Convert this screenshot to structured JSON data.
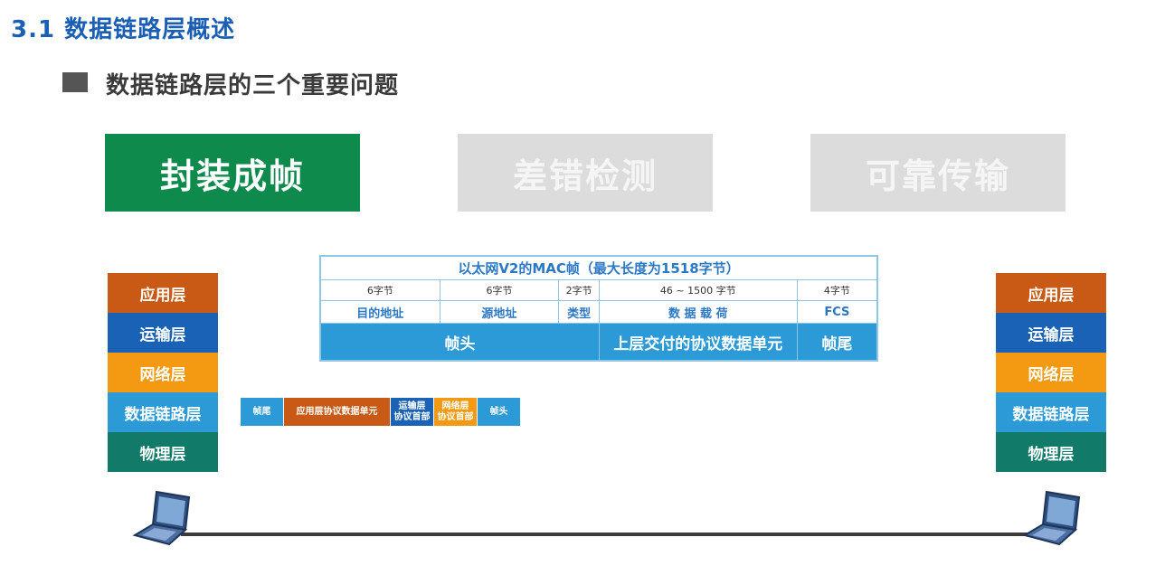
{
  "header": {
    "title": "3.1 数据链路层概述",
    "subtitle": "数据链路层的三个重要问题"
  },
  "tabs": [
    {
      "label": "封装成帧",
      "active": true
    },
    {
      "label": "差错检测",
      "active": false
    },
    {
      "label": "可靠传输",
      "active": false
    }
  ],
  "layers": [
    {
      "label": "应用层",
      "color": "#c85a16"
    },
    {
      "label": "运输层",
      "color": "#1a62b5"
    },
    {
      "label": "网络层",
      "color": "#f39a12"
    },
    {
      "label": "数据链路层",
      "color": "#2c9ad6"
    },
    {
      "label": "物理层",
      "color": "#127a68"
    }
  ],
  "frame": {
    "title": "以太网V2的MAC帧（最大长度为1518字节）",
    "bytes": [
      "6字节",
      "6字节",
      "2字节",
      "46 ~ 1500 字节",
      "4字节"
    ],
    "fields": [
      "目的地址",
      "源地址",
      "类型",
      "数 据 载 荷",
      "FCS"
    ],
    "bar": {
      "head": "帧头",
      "payload": "上层交付的协议数据单元",
      "tail": "帧尾"
    }
  },
  "pdu": [
    {
      "label": "帧尾",
      "color": "#2c9ad6"
    },
    {
      "label": "应用层协议数据单元",
      "color": "#c85a16"
    },
    {
      "label": "运输层\n协议首部",
      "color": "#1a62b5"
    },
    {
      "label": "网络层\n协议首部",
      "color": "#f39a12"
    },
    {
      "label": "帧头",
      "color": "#2c9ad6"
    }
  ],
  "icons": {
    "left_host": "laptop-icon",
    "right_host": "laptop-icon"
  }
}
